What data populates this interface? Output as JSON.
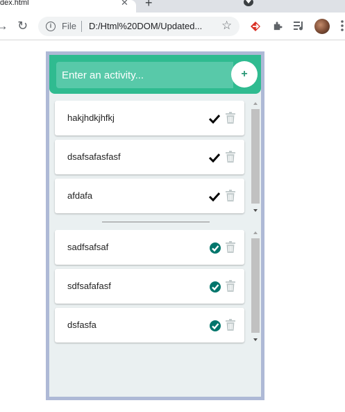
{
  "browser": {
    "tab_title": "dex.html",
    "tab_close": "✕",
    "new_tab": "+",
    "file_label": "File",
    "url": "D:/Html%20DOM/Updated...",
    "icons": [
      "back-arrow-icon",
      "reload-icon",
      "info-icon",
      "star-icon",
      "extension-icon",
      "puzzle-icon",
      "media-icon",
      "avatar",
      "menu-icon"
    ]
  },
  "header": {
    "input_placeholder": "Enter an activity...",
    "add_label": "+"
  },
  "todo_list": [
    {
      "text": "hakjhdkjhfkj"
    },
    {
      "text": "dsafsafasfasf"
    },
    {
      "text": "afdafa"
    }
  ],
  "done_list": [
    {
      "text": "sadfsafsaf"
    },
    {
      "text": "sdfsafafasf"
    },
    {
      "text": "dsfasfa"
    }
  ],
  "colors": {
    "header_green": "#2fbb90",
    "input_green": "#58c9a9",
    "done_teal": "#00766c",
    "panel_bg": "#eaf0f1",
    "panel_border": "#aeb9d6",
    "trash_gray": "#c2cbcc"
  }
}
